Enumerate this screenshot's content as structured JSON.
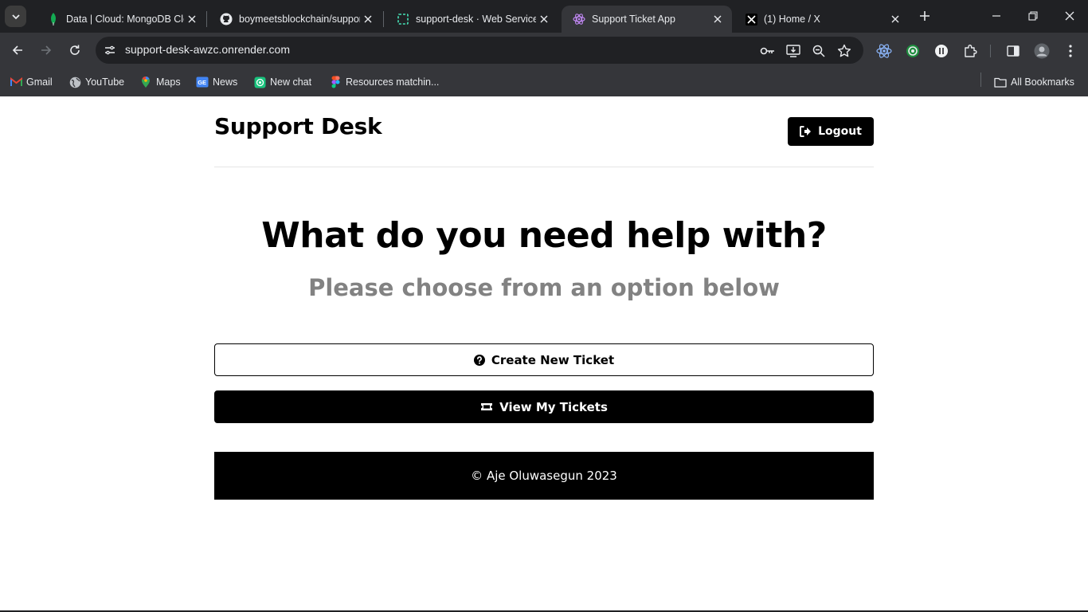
{
  "browser": {
    "tabs": [
      {
        "title": "Data | Cloud: MongoDB Cloud",
        "icon": "mongodb-leaf-icon",
        "active": false
      },
      {
        "title": "boymeetsblockchain/support-desk",
        "icon": "github-icon",
        "active": false
      },
      {
        "title": "support-desk · Web Service",
        "icon": "render-icon",
        "active": false
      },
      {
        "title": "Support Ticket App",
        "icon": "react-atom-icon",
        "active": true
      },
      {
        "title": "(1) Home / X",
        "icon": "x-logo-icon",
        "active": false
      }
    ],
    "url": "support-desk-awzc.onrender.com",
    "bookmarks": [
      {
        "label": "Gmail",
        "icon": "gmail-icon"
      },
      {
        "label": "YouTube",
        "icon": "globe-icon"
      },
      {
        "label": "Maps",
        "icon": "maps-pin-icon"
      },
      {
        "label": "News",
        "icon": "news-icon"
      },
      {
        "label": "New chat",
        "icon": "chatgpt-icon"
      },
      {
        "label": "Resources matchin...",
        "icon": "figma-icon"
      }
    ],
    "all_bookmarks_label": "All Bookmarks"
  },
  "app": {
    "title": "Support Desk",
    "logout_label": "Logout",
    "heading": "What do you need help with?",
    "subheading": "Please choose from an option below",
    "create_ticket_label": "Create New Ticket",
    "view_tickets_label": "View My Tickets",
    "footer_text": "© Aje Oluwasegun 2023"
  },
  "colors": {
    "browser_frame": "#202124",
    "toolbar": "#35363a",
    "page_background": "#ffffff",
    "primary_button": "#000000",
    "subheading_text": "#828282"
  }
}
